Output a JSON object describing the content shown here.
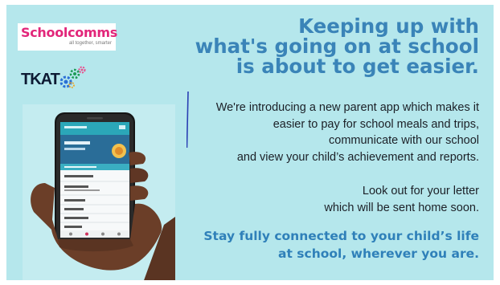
{
  "logos": {
    "schoolcomms": {
      "name": "Schoolcomms",
      "tagline": "all together, smarter",
      "color": "#e2267a"
    },
    "tkat": {
      "name": "TKAT",
      "color": "#0d1a33"
    }
  },
  "headline": {
    "lines": [
      "Keeping up with",
      "what's going on at school",
      "is about to get easier."
    ],
    "color": "#3a84b8"
  },
  "intro": {
    "lines": [
      "We're introducing a new parent app which makes it",
      "easier to pay for school meals and trips,",
      "communicate with our school",
      "and view your child’s achievement and reports."
    ]
  },
  "lookout": {
    "lines": [
      "Look out for your letter",
      "which will be sent home soon."
    ]
  },
  "tagline": {
    "lines": [
      "Stay fully connected to your child’s life",
      "at school, wherever you are."
    ],
    "color": "#2f80b9"
  },
  "colors": {
    "background": "#b5e7ec",
    "divider": "#2a3fb3",
    "app_header": "#2ba7b8",
    "app_banner": "#2a6d98"
  }
}
